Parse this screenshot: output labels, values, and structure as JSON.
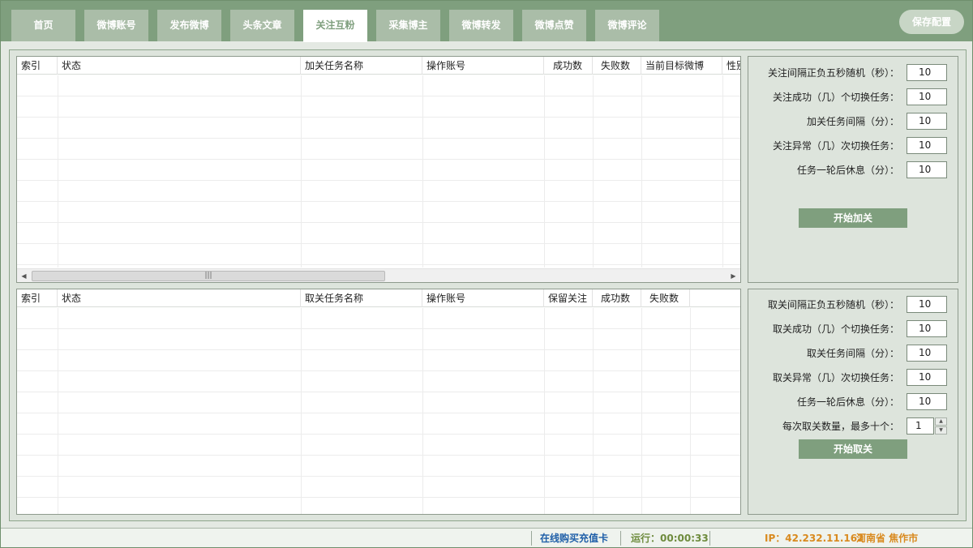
{
  "tabs": [
    {
      "label": "首页",
      "active": false
    },
    {
      "label": "微博账号",
      "active": false
    },
    {
      "label": "发布微博",
      "active": false
    },
    {
      "label": "头条文章",
      "active": false
    },
    {
      "label": "关注互粉",
      "active": true
    },
    {
      "label": "采集博主",
      "active": false
    },
    {
      "label": "微博转发",
      "active": false
    },
    {
      "label": "微博点赞",
      "active": false
    },
    {
      "label": "微博评论",
      "active": false
    }
  ],
  "save_config_label": "保存配置",
  "follow_grid": {
    "columns": [
      "索引",
      "状态",
      "加关任务名称",
      "操作账号",
      "成功数",
      "失败数",
      "当前目标微博",
      "性别"
    ]
  },
  "unfollow_grid": {
    "columns": [
      "索引",
      "状态",
      "取关任务名称",
      "操作账号",
      "保留关注",
      "成功数",
      "失败数"
    ]
  },
  "follow_panel": {
    "fields": [
      {
        "label": "关注间隔正负五秒随机（秒）：",
        "value": "10"
      },
      {
        "label": "关注成功（几）个切换任务：",
        "value": "10"
      },
      {
        "label": "加关任务间隔（分）：",
        "value": "10"
      },
      {
        "label": "关注异常（几）次切换任务：",
        "value": "10"
      },
      {
        "label": "任务一轮后休息（分）：",
        "value": "10"
      }
    ],
    "start_label": "开始加关"
  },
  "unfollow_panel": {
    "fields": [
      {
        "label": "取关间隔正负五秒随机（秒）：",
        "value": "10"
      },
      {
        "label": "取关成功（几）个切换任务：",
        "value": "10"
      },
      {
        "label": "取关任务间隔（分）：",
        "value": "10"
      },
      {
        "label": "取关异常（几）次切换任务：",
        "value": "10"
      },
      {
        "label": "任务一轮后休息（分）：",
        "value": "10"
      }
    ],
    "count_label": "每次取关数量，最多十个：",
    "count_value": "1",
    "start_label": "开始取关"
  },
  "statusbar": {
    "buy_link": "在线购买充值卡",
    "runtime": "运行：00:00:33",
    "ip": "IP：42.232.11.162",
    "location": "河南省 焦作市"
  },
  "colors": {
    "accent": "#7f9f7e",
    "link": "#1f5fa8",
    "runtime": "#6e8b3d",
    "ip": "#d98a1f"
  }
}
